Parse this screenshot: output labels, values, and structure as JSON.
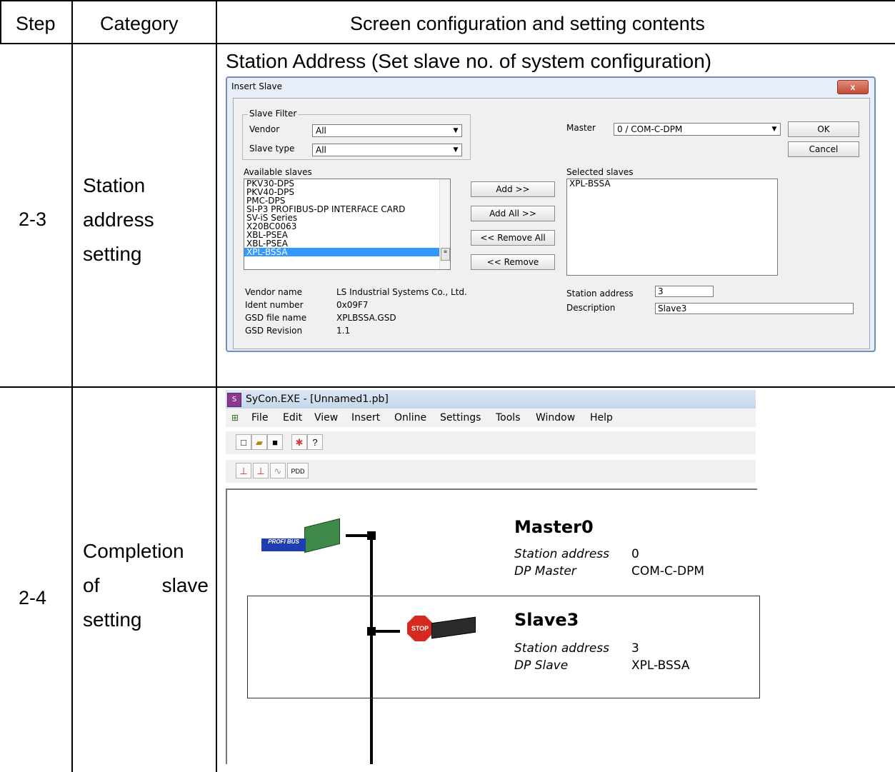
{
  "header": {
    "step": "Step",
    "category": "Category",
    "contents": "Screen configuration and setting contents"
  },
  "rows": [
    {
      "step": "2-3",
      "category": [
        "Station",
        "address",
        "setting"
      ],
      "caption": "Station Address (Set slave no. of system configuration)"
    },
    {
      "step": "2-4",
      "category": [
        "Completion",
        "of",
        "slave",
        "setting"
      ]
    }
  ],
  "dialog": {
    "title": "Insert Slave",
    "close": "x",
    "slave_filter_label": "Slave Filter",
    "vendor_label": "Vendor",
    "vendor_value": "All",
    "slave_type_label": "Slave type",
    "slave_type_value": "All",
    "master_label": "Master",
    "master_value": "0 / COM-C-DPM",
    "ok": "OK",
    "cancel": "Cancel",
    "available_label": "Available slaves",
    "available": [
      "PKV30-DPS",
      "PKV40-DPS",
      "PMC-DPS",
      "SI-P3 PROFIBUS-DP INTERFACE CARD",
      "SV-iS Series",
      "X20BC0063",
      "XBL-PSEA",
      "XBL-PSEA",
      "XPL-BSSA"
    ],
    "selected_label": "Selected slaves",
    "selected": [
      "XPL-BSSA"
    ],
    "add": "Add >>",
    "add_all": "Add All >>",
    "remove_all": "<< Remove All",
    "remove": "<< Remove",
    "vendor_name_label": "Vendor name",
    "vendor_name": "LS Industrial Systems Co., Ltd.",
    "ident_label": "Ident number",
    "ident": "0x09F7",
    "gsd_file_label": "GSD file name",
    "gsd_file": "XPLBSSA.GSD",
    "gsd_rev_label": "GSD Revision",
    "gsd_rev": "1.1",
    "station_address_label": "Station address",
    "station_address": "3",
    "description_label": "Description",
    "description": "Slave3"
  },
  "sycon": {
    "title": "SyCon.EXE - [Unnamed1.pb]",
    "menu": [
      "File",
      "Edit",
      "View",
      "Insert",
      "Online",
      "Settings",
      "Tools",
      "Window",
      "Help"
    ],
    "pdd": "PDD",
    "master": {
      "name": "Master0",
      "addr_label": "Station address",
      "addr": "0",
      "type_label": "DP Master",
      "type": "COM-C-DPM",
      "logo_text": "PROFI BUS"
    },
    "slave": {
      "name": "Slave3",
      "addr_label": "Station address",
      "addr": "3",
      "type_label": "DP Slave",
      "type": "XPL-BSSA",
      "stop_text": "STOP"
    }
  }
}
